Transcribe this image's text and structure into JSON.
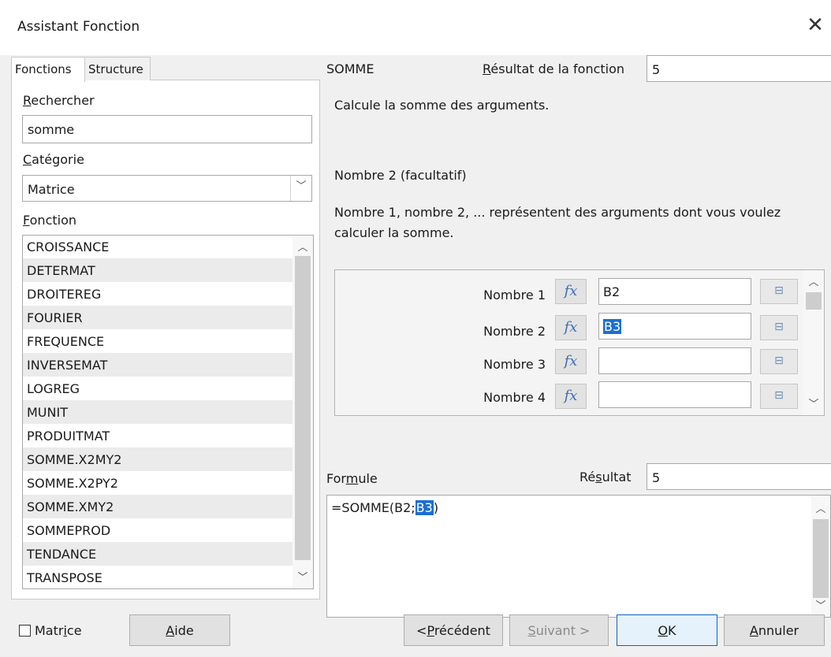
{
  "window": {
    "title": "Assistant Fonction"
  },
  "tabs": [
    "Fonctions",
    "Structure"
  ],
  "search": {
    "label_underlined": "R",
    "label_rest": "echercher",
    "value": "somme"
  },
  "category": {
    "label_underlined": "C",
    "label_rest": "atégorie",
    "value": "Matrice"
  },
  "function_list": {
    "label_underlined": "F",
    "label_rest": "onction",
    "items": [
      "CROISSANCE",
      "DETERMAT",
      "DROITEREG",
      "FOURIER",
      "FREQUENCE",
      "INVERSEMAT",
      "LOGREG",
      "MUNIT",
      "PRODUITMAT",
      "SOMME.X2MY2",
      "SOMME.X2PY2",
      "SOMME.XMY2",
      "SOMMEPROD",
      "TENDANCE",
      "TRANSPOSE"
    ]
  },
  "function": {
    "name": "SOMME",
    "result_label_underlined": "R",
    "result_label_rest": "ésultat de la fonction",
    "result_value": "5",
    "description": "Calcule la somme des arguments.",
    "arg_title": "Nombre 2 (facultatif)",
    "arg_desc_line1": "Nombre 1, nombre 2, ... représentent des arguments dont vous voulez",
    "arg_desc_line2": "calculer la somme."
  },
  "args": [
    {
      "label": "Nombre 1",
      "value": "B2"
    },
    {
      "label": "Nombre 2",
      "value": "B3"
    },
    {
      "label": "Nombre 3",
      "value": ""
    },
    {
      "label": "Nombre 4",
      "value": ""
    }
  ],
  "fx_glyph": "fx",
  "formula": {
    "label_pre": "For",
    "label_underlined": "m",
    "label_rest": "ule",
    "result_pre": "Ré",
    "result_underlined": "s",
    "result_rest": "ultat",
    "result_value": "5",
    "text_pre": "=SOMME(B2;",
    "text_sel": "B3",
    "text_post": ")"
  },
  "footer": {
    "matrix_pre": "Matr",
    "matrix_underlined": "i",
    "matrix_rest": "ce",
    "help_underlined": "A",
    "help_rest": "ide",
    "prev_pre": "<",
    "prev_underlined": "P",
    "prev_rest": "récédent",
    "next_underlined": "S",
    "next_rest": "uivant >",
    "ok_underlined": "O",
    "ok_rest": "K",
    "cancel_underlined": "A",
    "cancel_rest": "nnuler"
  },
  "icons": {
    "close": "close-icon",
    "fx": "function-wizard-icon",
    "shrink": "shrink-icon"
  }
}
